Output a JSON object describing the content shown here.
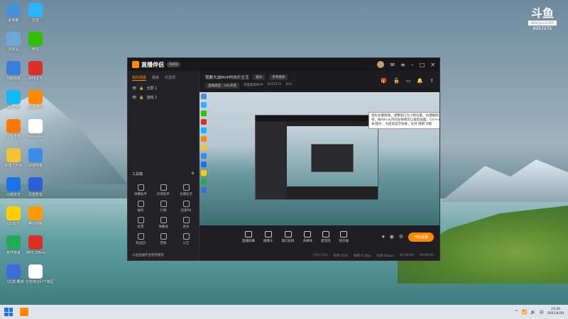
{
  "desktop": {
    "icons": [
      {
        "label": "此电脑",
        "color": "#4a90d9"
      },
      {
        "label": "迅雷",
        "color": "#2bb3ff"
      },
      {
        "label": "回收站",
        "color": "#6ea8d8"
      },
      {
        "label": "微信",
        "color": "#2dc100"
      },
      {
        "label": "控制面板",
        "color": "#3b7ddd"
      },
      {
        "label": "WPS文字",
        "color": "#d93025"
      },
      {
        "label": "腾讯QQ",
        "color": "#12b7f5"
      },
      {
        "label": "直播伴侣",
        "color": "#ff8a00"
      },
      {
        "label": "斗鱼直播",
        "color": "#ff7700"
      },
      {
        "label": "WeGame",
        "color": "#ffffff"
      },
      {
        "label": "新建文件夹",
        "color": "#f4c430"
      },
      {
        "label": "百度网盘",
        "color": "#3a8ee6"
      },
      {
        "label": "火绒安全",
        "color": "#1a73e8"
      },
      {
        "label": "迅雷影音",
        "color": "#2a62d6"
      },
      {
        "label": "QQ音乐",
        "color": "#ffce00"
      },
      {
        "label": "腾讯视频",
        "color": "#ff9900"
      },
      {
        "label": "软件管家",
        "color": "#22aa55"
      },
      {
        "label": "WPS Office",
        "color": "#d93025"
      },
      {
        "label": "QQ影音",
        "color": "#3b6de0"
      },
      {
        "label": "更新-分包待访问下载区",
        "color": "#ffffff"
      }
    ]
  },
  "watermark": {
    "top": "斗鱼",
    "box": "douyu.com",
    "id": "9257275"
  },
  "app": {
    "name": "直播伴侣",
    "version": "beta",
    "side_tabs": [
      "我的场景",
      "模板",
      "可选项"
    ],
    "scenes": [
      "全屏 1",
      "游戏 1"
    ],
    "toolbox_title": "工具箱",
    "tools": [
      "弹幕助手",
      "房管助手",
      "主播任务",
      "抽奖",
      "礼物",
      "连麦PK",
      "投票",
      "弹幕墙",
      "更多",
      "粉丝团",
      "营收",
      "公告"
    ],
    "sidebar_footer": "斗鱼直播伴侣使用教程",
    "room_title": "我要大战MVP的快乐生活",
    "room_chip": "娱乐",
    "room_chip2": "参考搜索",
    "room_sub": [
      "直播类型：LOL开黑",
      "英雄联盟MVP",
      "9257275",
      "853"
    ],
    "tooltip": "鼠标左键拖拽，调整窗口大小和位置。右键删除当前素材，按Alt+从内向左拖拽可以裁剪画面。Ctrl+V粘贴文本/图片，为提高显示效果，支持‘透明’功能",
    "controls": [
      "直播屏幕",
      "摄像头",
      "窗口投屏",
      "多媒体",
      "麦克风",
      "扬声器"
    ],
    "live_button": "开始直播",
    "status": [
      "CPU:13%",
      "内存:25%",
      "帧率:0.0fps",
      "码率:0kbps",
      "00:00:00",
      "00:00:05"
    ]
  },
  "taskbar": {
    "tray_lang": "中",
    "time": "23:26",
    "date": "2021/4/30"
  }
}
